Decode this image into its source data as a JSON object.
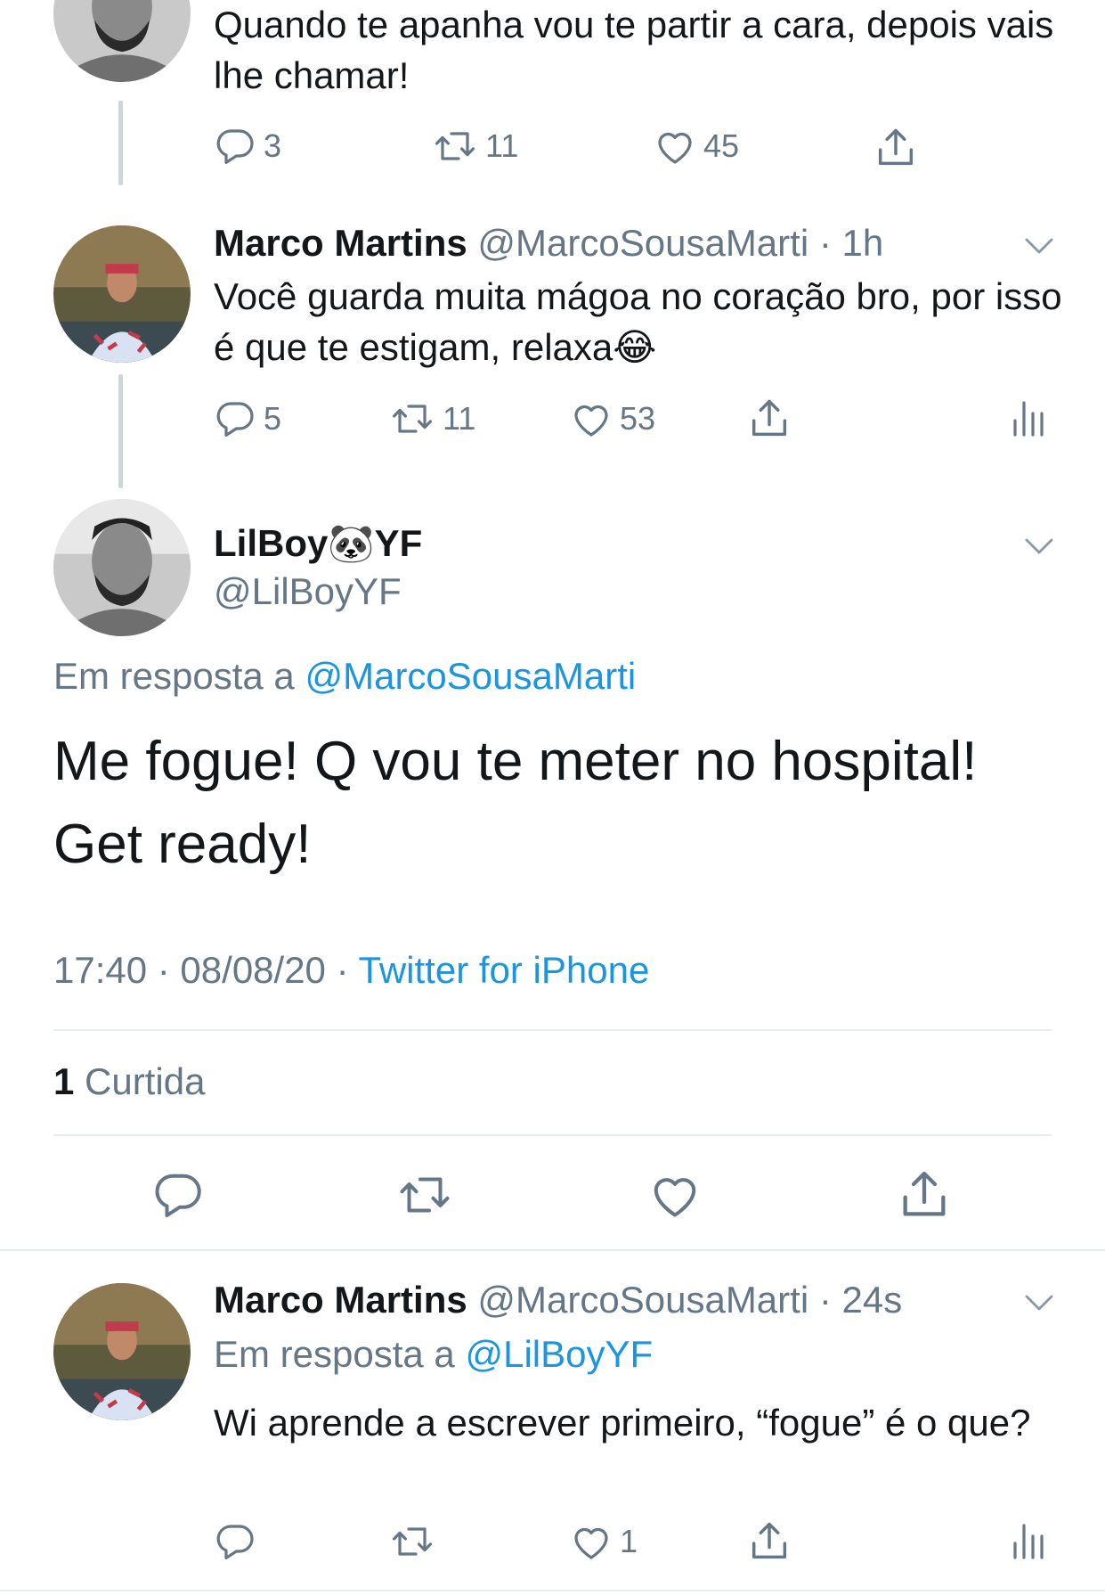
{
  "tweets": [
    {
      "text": "Quando te apanha vou te partir a cara, depois vais lhe chamar!",
      "replies": "3",
      "retweets": "11",
      "likes": "45"
    },
    {
      "name": "Marco Martins",
      "handle": "@MarcoSousaMarti",
      "time": "· 1h",
      "text": "Você guarda muita mágoa no coração bro, por isso é que te estigam, relaxa😂",
      "replies": "5",
      "retweets": "11",
      "likes": "53"
    }
  ],
  "main": {
    "name": "LilBoy🐼YF",
    "handle": "@LilBoyYF",
    "reply_prefix": "Em resposta a",
    "reply_to": "@MarcoSousaMarti",
    "text": "Me fogue! Q vou te meter no hospital! Get ready!",
    "time": "17:40 · 08/08/20 ·",
    "source": "Twitter for iPhone",
    "likes_count": "1",
    "likes_label": "Curtida"
  },
  "reply": {
    "name": "Marco Martins",
    "handle": "@MarcoSousaMarti",
    "time": "· 24s",
    "reply_prefix": "Em resposta a",
    "reply_to": "@LilBoyYF",
    "text": "Wi aprende a escrever primeiro, “fogue” é o que?",
    "replies": "",
    "retweets": "",
    "likes": "1"
  },
  "colors": {
    "accent": "#1b95e0",
    "muted": "#657786",
    "border": "#e6ecf0",
    "thread": "#ccd6dd"
  },
  "icons": [
    "reply-icon",
    "retweet-icon",
    "like-icon",
    "share-icon",
    "analytics-icon",
    "chevron-down-icon"
  ]
}
